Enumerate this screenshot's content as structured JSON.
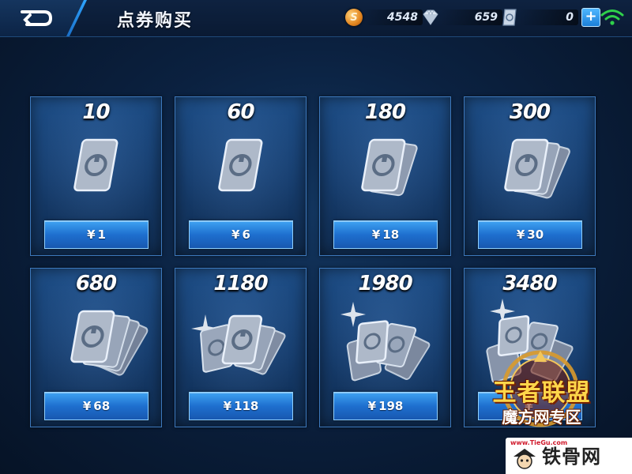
{
  "header": {
    "title": "点券购买",
    "gold": "4548",
    "gold_icon": "gold-coin-icon",
    "diamond": "659",
    "diamond_icon": "diamond-icon",
    "voucher": "0",
    "voucher_icon": "voucher-card-icon",
    "add_label": "+",
    "gold_coin_glyph": "S"
  },
  "packages": [
    {
      "amount": "10",
      "currency": "¥",
      "price": "1"
    },
    {
      "amount": "60",
      "currency": "¥",
      "price": "6"
    },
    {
      "amount": "180",
      "currency": "¥",
      "price": "18"
    },
    {
      "amount": "300",
      "currency": "¥",
      "price": "30"
    },
    {
      "amount": "680",
      "currency": "¥",
      "price": "68"
    },
    {
      "amount": "1180",
      "currency": "¥",
      "price": "118"
    },
    {
      "amount": "1980",
      "currency": "¥",
      "price": "198"
    },
    {
      "amount": "3480",
      "currency": "¥",
      "price": ""
    }
  ],
  "watermarks": {
    "kog_line1": "王者联盟",
    "kog_line2": "魔方网专区",
    "tiegu_name": "铁骨网",
    "tiegu_url": "www.TieGu.com"
  },
  "colors": {
    "accent": "#2ea4ff",
    "button": "#1e6fcf",
    "background": "#0b2140"
  }
}
